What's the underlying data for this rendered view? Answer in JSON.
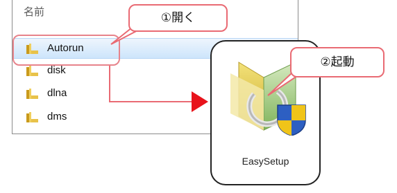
{
  "explorer": {
    "column_header": "名前",
    "rows": [
      {
        "label": "Autorun",
        "selected": true
      },
      {
        "label": "disk",
        "selected": false
      },
      {
        "label": "dlna",
        "selected": false
      },
      {
        "label": "dms",
        "selected": false
      }
    ]
  },
  "callouts": {
    "step1": "①開く",
    "step2": "②起動"
  },
  "app": {
    "label": "EasySetup",
    "icon": "easysetup-app-icon"
  },
  "colors": {
    "highlight": "#e96a73",
    "arrow": "#e8131b",
    "selection": "#cde5fb",
    "folder": "#e8c24a"
  }
}
